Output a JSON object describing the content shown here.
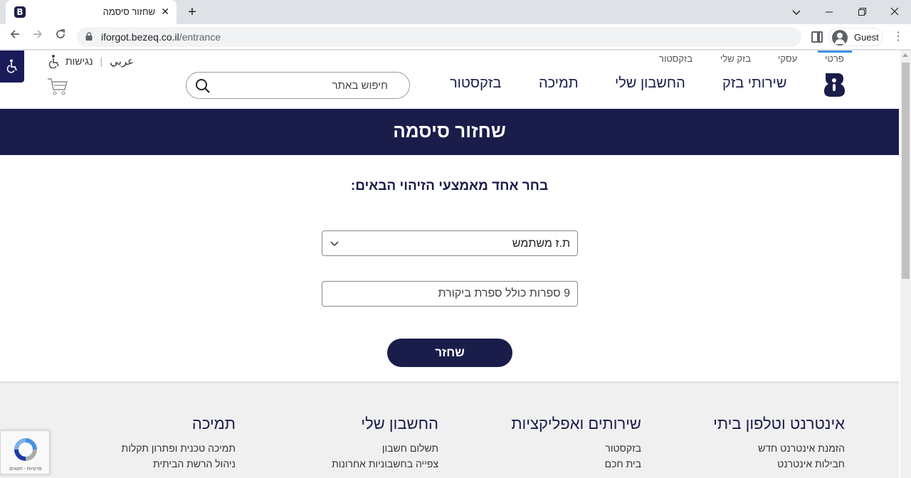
{
  "browser": {
    "tab_title": "שחזור סיסמה",
    "url_host": "iforgot.bezeq.co.il",
    "url_path": "/entrance",
    "profile_name": "Guest",
    "favicon_letter": "B"
  },
  "header": {
    "top_links": [
      "פרטי",
      "עסקי",
      "בזק שלי",
      "בזקסטור"
    ],
    "lang_arabic": "عربي",
    "accessibility": "נגישות",
    "nav": [
      "שירותי בזק",
      "החשבון שלי",
      "תמיכה",
      "בזקסטור"
    ],
    "search_placeholder": "חיפוש באתר"
  },
  "banner": {
    "title": "שחזור סיסמה"
  },
  "form": {
    "subtitle": "בחר אחד מאמצעי הזיהוי הבאים:",
    "id_type": "ת.ז משתמש",
    "id_placeholder": "9 ספרות כולל ספרת ביקורת",
    "submit": "שחזר"
  },
  "footer": {
    "columns": [
      {
        "title": "אינטרנט וטלפון ביתי",
        "links": [
          "הזמנת אינטרנט חדש",
          "חבילות אינטרנט"
        ]
      },
      {
        "title": "שירותים ואפליקציות",
        "links": [
          "בזקסטור",
          "בית חכם"
        ]
      },
      {
        "title": "החשבון שלי",
        "links": [
          "תשלום חשבון",
          "צפייה בחשבוניות אחרונות"
        ]
      },
      {
        "title": "תמיכה",
        "links": [
          "תמיכה טכנית ופתרון תקלות",
          "ניהול הרשת הביתית"
        ]
      }
    ]
  },
  "recaptcha": {
    "text": "פרטיות - תנאים"
  },
  "colors": {
    "brand_navy": "#1a1c4a",
    "active_tab_line": "#3a8ee6"
  }
}
